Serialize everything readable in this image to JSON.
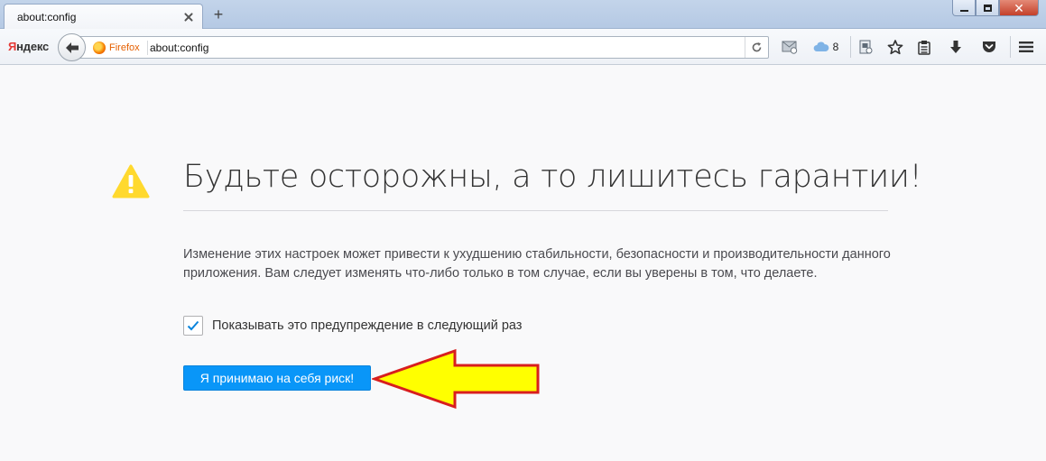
{
  "browser": {
    "tab": {
      "title": "about:config"
    },
    "brand_first_letter": "Я",
    "brand_rest": "ндекс",
    "identity_label": "Firefox",
    "url": "about:config",
    "sync_count": "8"
  },
  "page": {
    "heading": "Будьте осторожны, а то лишитесь гарантии!",
    "description": "Изменение этих настроек может привести к ухудшению стабильности, безопасности и производительности данного приложения. Вам следует изменять что-либо только в том случае, если вы уверены в том, что делаете.",
    "checkbox_label": "Показывать это предупреждение в следующий раз",
    "checkbox_checked": true,
    "accept_button": "Я принимаю на себя риск!"
  },
  "annotation": {
    "arrow_color": "#ffff00",
    "arrow_outline": "#d81e1e"
  },
  "colors": {
    "accent": "#0996f8",
    "warning": "#ffd92e"
  }
}
